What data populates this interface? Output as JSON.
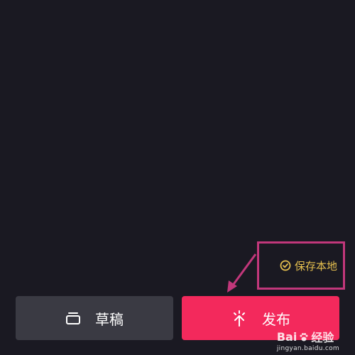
{
  "save_local": {
    "label": "保存本地",
    "icon": "check-circle-icon",
    "color": "#e6c04f"
  },
  "annotation": {
    "border_color": "#c2377b"
  },
  "bottom_bar": {
    "draft_label": "草稿",
    "draft_icon": "draft-box-icon",
    "publish_label": "发布",
    "publish_icon": "publish-upload-icon",
    "publish_color": "#f3295c",
    "draft_color": "#3a3a43"
  },
  "watermark": {
    "brand": "Bai",
    "brand_suffix": "经验",
    "url": "jingyan.baidu.com"
  }
}
